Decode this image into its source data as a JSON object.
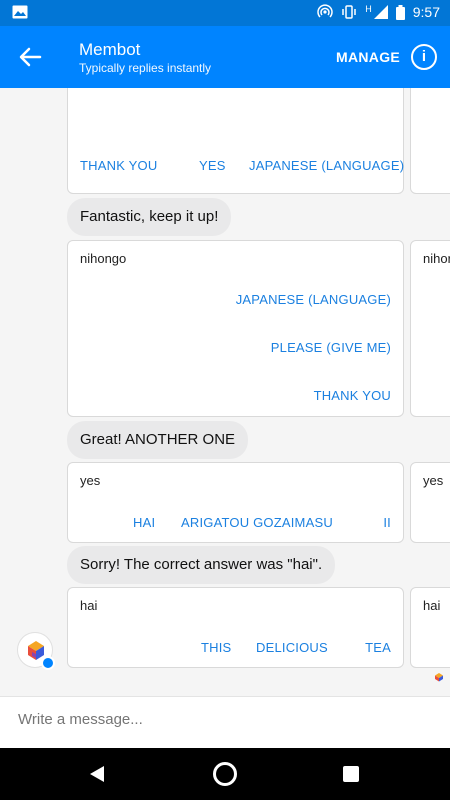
{
  "status_bar": {
    "time": "9:57",
    "network_label": "H",
    "icons": [
      "image-icon",
      "hotspot-icon",
      "vibrate-icon",
      "signal-icon",
      "battery-icon"
    ]
  },
  "header": {
    "title": "Membot",
    "subtitle": "Typically replies instantly",
    "manage_label": "MANAGE",
    "info_label": "i"
  },
  "messages": {
    "card1": {
      "options": [
        "THANK YOU",
        "YES",
        "JAPANESE (LANGUAGE)"
      ]
    },
    "bubble1": "Fantastic, keep it up!",
    "card2": {
      "term": "nihongo",
      "peek": "nihor",
      "options": [
        "JAPANESE (LANGUAGE)",
        "PLEASE (GIVE ME)",
        "THANK YOU"
      ]
    },
    "bubble2": "Great! ANOTHER ONE",
    "card3": {
      "term": "yes",
      "peek": "yes",
      "options": [
        "HAI",
        "ARIGATOU GOZAIMASU",
        "II"
      ]
    },
    "bubble3": "Sorry! The correct answer was \"hai\".",
    "card4": {
      "term": "hai",
      "peek": "hai",
      "options": [
        "THIS",
        "DELICIOUS",
        "TEA"
      ]
    }
  },
  "composer": {
    "placeholder": "Write a message..."
  },
  "colors": {
    "brand": "#0084ff",
    "status_bar": "#0276d6",
    "option_text": "#1b80e0",
    "bubble": "#e9e9ea"
  }
}
